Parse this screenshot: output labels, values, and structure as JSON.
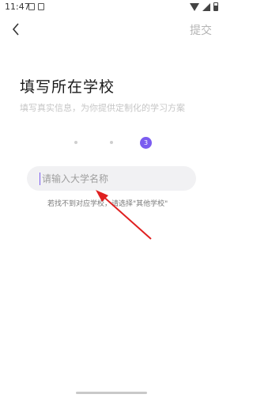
{
  "status_bar": {
    "time": "11:47"
  },
  "header": {
    "submit_label": "提交"
  },
  "page": {
    "title": "填写所在学校",
    "subtitle": "填写真实信息，为你提供定制化的学习方案"
  },
  "steps": {
    "current": "3",
    "total": 3
  },
  "school_input": {
    "placeholder": "请输入大学名称",
    "value": ""
  },
  "hint": {
    "text": "若找不到对应学校，请选择\"其他学校\""
  },
  "colors": {
    "accent": "#7b5cf0",
    "submit_disabled": "#b4b4b4",
    "annotation_arrow": "#e02020"
  }
}
